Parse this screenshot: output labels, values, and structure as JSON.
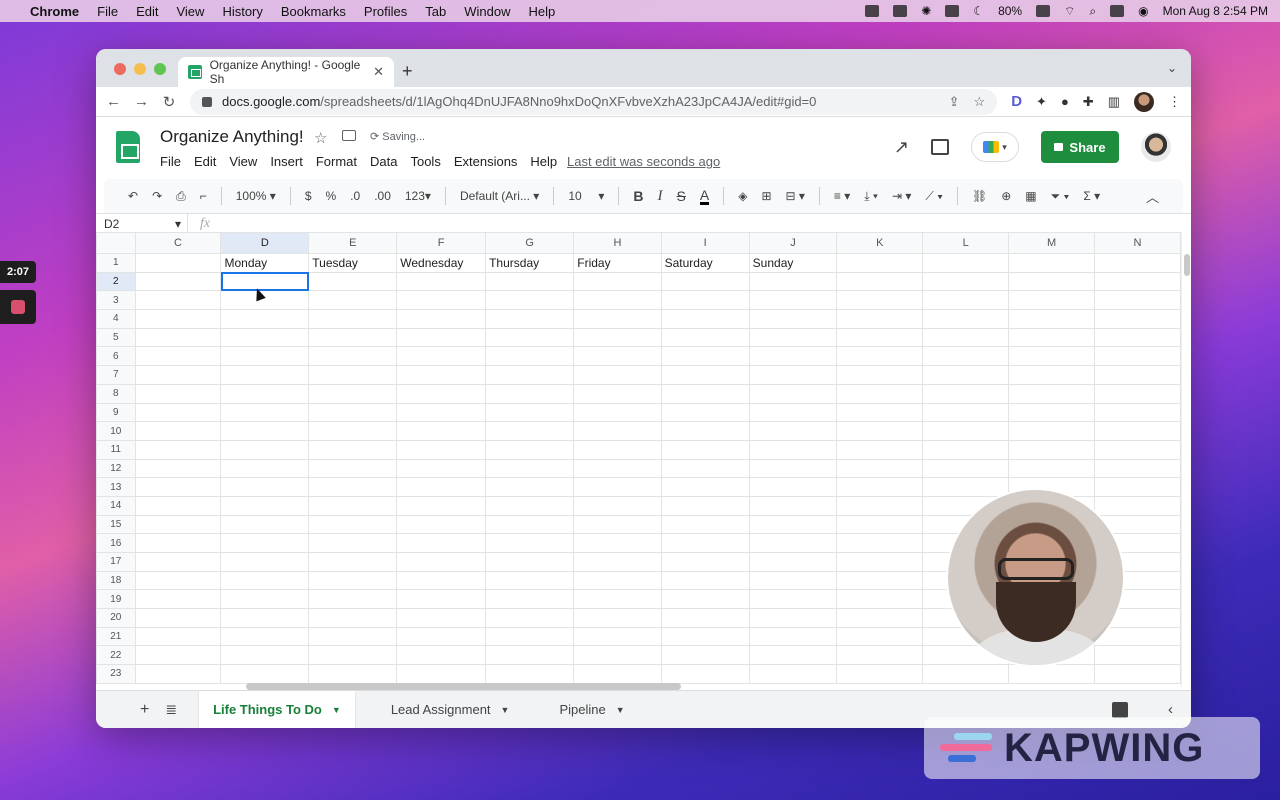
{
  "menubar": {
    "app": "Chrome",
    "items": [
      "File",
      "Edit",
      "View",
      "History",
      "Bookmarks",
      "Profiles",
      "Tab",
      "Window",
      "Help"
    ],
    "battery": "80%",
    "datetime": "Mon Aug 8  2:54 PM"
  },
  "recorder": {
    "time": "2:07"
  },
  "browser": {
    "tab_title": "Organize Anything! - Google Sh",
    "url_domain": "docs.google.com",
    "url_path": "/spreadsheets/d/1lAgOhq4DnUJFA8Nno9hxDoQnXFvbveXzhA23JpCA4JA/edit#gid=0"
  },
  "doc": {
    "title": "Organize Anything!",
    "status": "Saving...",
    "menu": [
      "File",
      "Edit",
      "View",
      "Insert",
      "Format",
      "Data",
      "Tools",
      "Extensions",
      "Help"
    ],
    "last_edit": "Last edit was seconds ago",
    "share_label": "Share"
  },
  "toolbar": {
    "zoom": "100%",
    "currency": "$",
    "percent": "%",
    "dec_less": ".0",
    "dec_more": ".00",
    "format_more": "123",
    "font": "Default (Ari...",
    "font_size": "10",
    "bold": "B",
    "italic": "I",
    "strike": "S",
    "text_color": "A"
  },
  "formula_bar": {
    "name_box": "D2",
    "fx": "fx"
  },
  "grid": {
    "columns": [
      "C",
      "D",
      "E",
      "F",
      "G",
      "H",
      "I",
      "J",
      "K",
      "L",
      "M",
      "N"
    ],
    "selected_column": "D",
    "selected_row": "2",
    "rows": [
      "1",
      "2",
      "3",
      "4",
      "5",
      "6",
      "7",
      "8",
      "9",
      "10",
      "11",
      "12",
      "13",
      "14",
      "15",
      "16",
      "17",
      "18",
      "19",
      "20",
      "21",
      "22",
      "23"
    ],
    "row1": [
      "",
      "Monday",
      "Tuesday",
      "Wednesday",
      "Thursday",
      "Friday",
      "Saturday",
      "Sunday",
      "",
      "",
      "",
      ""
    ]
  },
  "sheets": {
    "tabs": [
      "Life Things To Do",
      "Lead Assignment",
      "Pipeline"
    ],
    "active": "Life Things To Do"
  },
  "watermark": {
    "text": "KAPWING"
  }
}
